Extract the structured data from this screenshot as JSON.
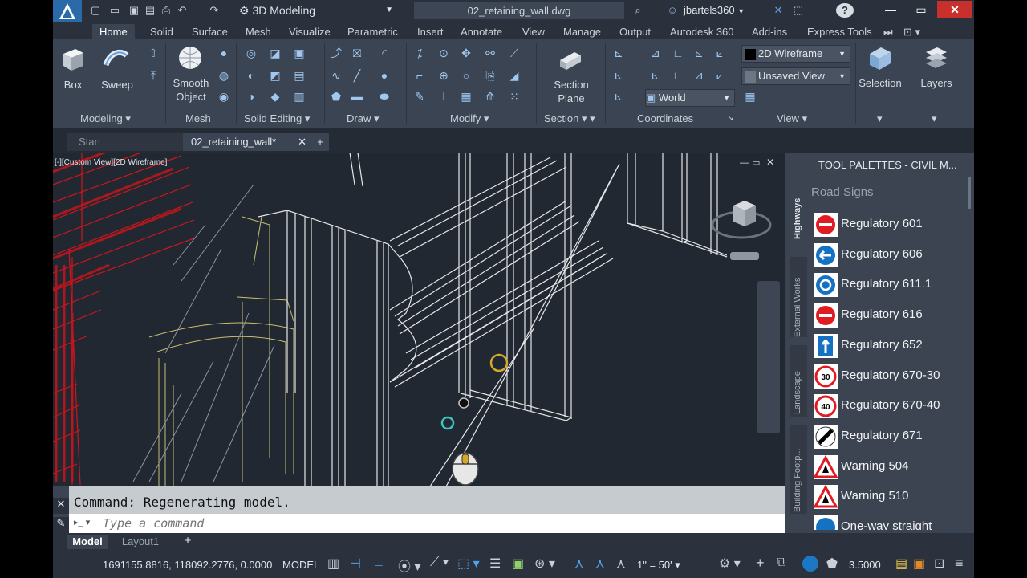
{
  "window": {
    "workspace": "3D Modeling",
    "doc_title": "02_retaining_wall.dwg",
    "user": "jbartels360",
    "help": "?"
  },
  "ribbon": {
    "tabs": [
      "Home",
      "Solid",
      "Surface",
      "Mesh",
      "Visualize",
      "Parametric",
      "Insert",
      "Annotate",
      "View",
      "Manage",
      "Output",
      "Autodesk 360",
      "Add-ins",
      "Express Tools"
    ],
    "active_tab": "Home",
    "panels": [
      "Modeling",
      "Mesh",
      "Solid Editing",
      "Draw",
      "Modify",
      "Section",
      "Coordinates",
      "View"
    ],
    "box_label": "Box",
    "sweep_label": "Sweep",
    "smooth_object_label": "Smooth\nObject",
    "section_plane_label": "Section\nPlane",
    "selection_label": "Selection",
    "layers_label": "Layers",
    "visual_style": "2D Wireframe",
    "named_view": "Unsaved View",
    "ucs": "World"
  },
  "file_tabs": {
    "start": "Start",
    "active": "02_retaining_wall*",
    "add": "+"
  },
  "viewport": {
    "label": "[-][Custom View][2D Wireframe]"
  },
  "palette": {
    "title": "TOOL PALETTES - CIVIL M...",
    "section": "Road Signs",
    "side_tabs": [
      "Highways",
      "External Works",
      "Landscape",
      "Building Footp..."
    ],
    "items": [
      {
        "label": "Regulatory 601",
        "icon": "no-entry-icon"
      },
      {
        "label": "Regulatory 606",
        "icon": "left-arrow-sign-icon"
      },
      {
        "label": "Regulatory 611.1",
        "icon": "roundabout-sign-icon"
      },
      {
        "label": "Regulatory 616",
        "icon": "no-entry-icon"
      },
      {
        "label": "Regulatory 652",
        "icon": "one-way-sign-icon"
      },
      {
        "label": "Regulatory 670-30",
        "icon": "speed-30-sign-icon"
      },
      {
        "label": "Regulatory 670-40",
        "icon": "speed-40-sign-icon"
      },
      {
        "label": "Regulatory 671",
        "icon": "national-speed-sign-icon"
      },
      {
        "label": "Warning 504",
        "icon": "warning-triangle-icon"
      },
      {
        "label": "Warning 510",
        "icon": "warning-triangle-icon"
      },
      {
        "label": "One-way straight",
        "icon": "info-sign-icon"
      }
    ]
  },
  "command": {
    "history": "Command:  Regenerating model.",
    "placeholder": "Type a command"
  },
  "layout_tabs": {
    "model": "Model",
    "layout1": "Layout1",
    "add": "+"
  },
  "status": {
    "coords": "1691155.8816, 118092.2776, 0.0000",
    "mode": "MODEL",
    "scale": "1\" = 50'",
    "lineweight": "3.5000"
  },
  "colors": {
    "accent": "#1c78c4",
    "viewport_bg": "#212831",
    "ribbon_bg": "#3b4453",
    "hatch_red": "#d0151b",
    "wire_white": "#e6e6e6",
    "wire_yellow": "#d8cf7a"
  }
}
